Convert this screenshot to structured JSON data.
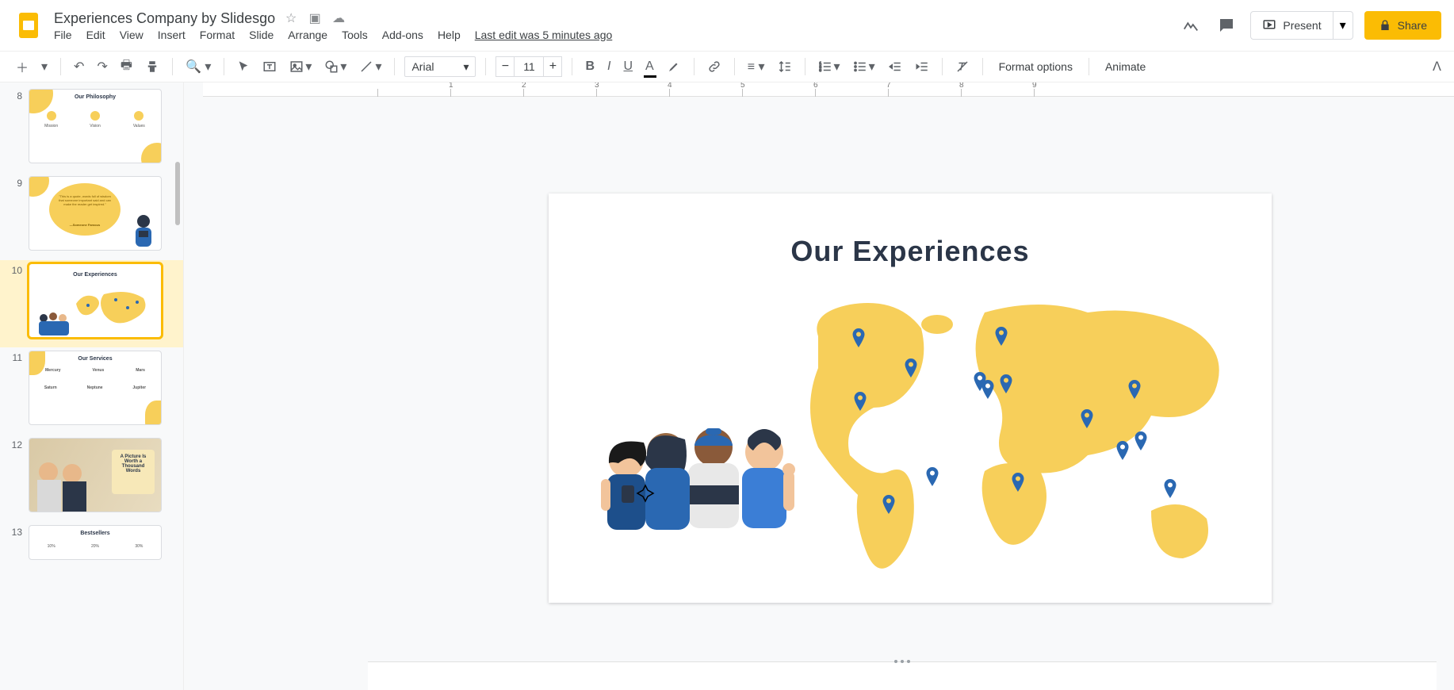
{
  "doc": {
    "title": "Experiences Company by Slidesgo"
  },
  "menu": {
    "file": "File",
    "edit": "Edit",
    "view": "View",
    "insert": "Insert",
    "format": "Format",
    "slide": "Slide",
    "arrange": "Arrange",
    "tools": "Tools",
    "addons": "Add-ons",
    "help": "Help",
    "last_edit": "Last edit was 5 minutes ago"
  },
  "actions": {
    "present": "Present",
    "share": "Share"
  },
  "toolbar": {
    "font": "Arial",
    "size": "11",
    "format_options": "Format options",
    "animate": "Animate"
  },
  "slides": {
    "n8": "8",
    "t8": "Our Philosophy",
    "s8a": "Mission",
    "s8b": "Vision",
    "s8c": "Values",
    "n9": "9",
    "t9_quote": "\"This is a quote, words full of wisdom that someone important said and can make the reader get inspired.\"",
    "t9_author": "—Someone Famous",
    "n10": "10",
    "t10": "Our Experiences",
    "n11": "11",
    "t11": "Our Services",
    "s11a": "Mercury",
    "s11b": "Venus",
    "s11c": "Mars",
    "s11d": "Saturn",
    "s11e": "Neptune",
    "s11f": "Jupiter",
    "n12": "12",
    "t12": "A Picture Is Worth a Thousand Words",
    "n13": "13",
    "t13": "Bestsellers",
    "p13a": "10%",
    "p13b": "20%",
    "p13c": "30%"
  },
  "ruler": {
    "m1": "1",
    "m2": "2",
    "m3": "3",
    "m4": "4",
    "m5": "5",
    "m6": "6",
    "m7": "7",
    "m8": "8",
    "m9": "9"
  },
  "canvas": {
    "title": "Our Experiences"
  }
}
